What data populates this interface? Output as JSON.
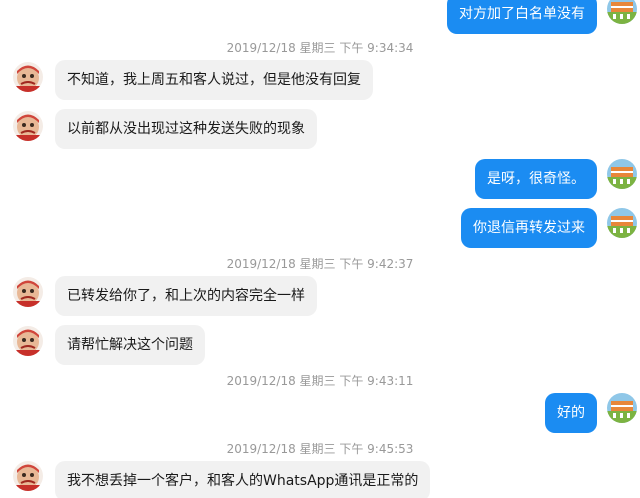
{
  "messages": [
    {
      "type": "out",
      "text": "对方加了白名单没有"
    },
    {
      "type": "time",
      "text": "2019/12/18 星期三 下午 9:34:34"
    },
    {
      "type": "in",
      "text": "不知道，我上周五和客人说过，但是他没有回复"
    },
    {
      "type": "in",
      "text": "以前都从没出现过这种发送失败的现象"
    },
    {
      "type": "out",
      "text": "是呀，很奇怪。"
    },
    {
      "type": "out",
      "text": "你退信再转发过来"
    },
    {
      "type": "time",
      "text": "2019/12/18 星期三 下午 9:42:37"
    },
    {
      "type": "in",
      "text": "已转发给你了，和上次的内容完全一样"
    },
    {
      "type": "in",
      "text": "请帮忙解决这个问题"
    },
    {
      "type": "time",
      "text": "2019/12/18 星期三 下午 9:43:11"
    },
    {
      "type": "out",
      "text": "好的"
    },
    {
      "type": "time",
      "text": "2019/12/18 星期三 下午 9:45:53"
    },
    {
      "type": "in",
      "text": "我不想丢掉一个客户，和客人的WhatsApp通讯是正常的"
    }
  ],
  "colors": {
    "outgoing_bubble": "#1b8cf2",
    "incoming_bubble": "#f1f1f1",
    "timestamp": "#999999"
  },
  "icons": {
    "incoming_avatar": "cartoon-face-avatar-icon",
    "outgoing_avatar": "landscape-avatar-icon"
  }
}
